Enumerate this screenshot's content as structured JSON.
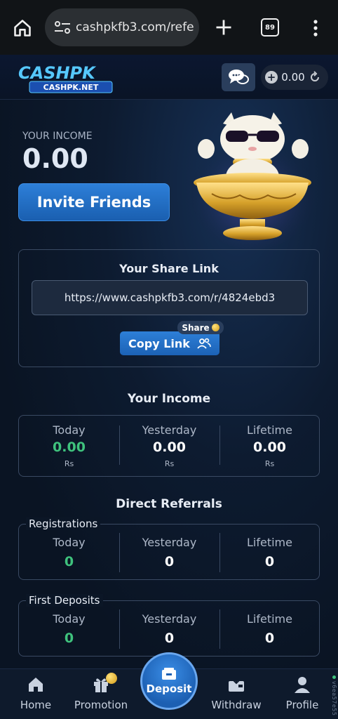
{
  "browser": {
    "url": "cashpkfb3.com/refe",
    "tab_count": "89"
  },
  "header": {
    "logo_main": "CASHPK",
    "logo_sub": "CASHPK.NET",
    "balance": "0.00"
  },
  "hero": {
    "income_label": "YOUR INCOME",
    "income_value": "0.00",
    "invite_label": "Invite Friends"
  },
  "share": {
    "title": "Your Share Link",
    "link": "https://www.cashpkfb3.com/r/4824ebd3",
    "copy_label": "Copy Link",
    "badge": "Share"
  },
  "income": {
    "title": "Your Income",
    "cols": [
      {
        "label": "Today",
        "value": "0.00",
        "unit": "Rs"
      },
      {
        "label": "Yesterday",
        "value": "0.00",
        "unit": "Rs"
      },
      {
        "label": "Lifetime",
        "value": "0.00",
        "unit": "Rs"
      }
    ]
  },
  "referrals": {
    "title": "Direct Referrals",
    "registrations": {
      "caption": "Registrations",
      "cols": [
        {
          "label": "Today",
          "value": "0"
        },
        {
          "label": "Yesterday",
          "value": "0"
        },
        {
          "label": "Lifetime",
          "value": "0"
        }
      ]
    },
    "first_deposits": {
      "caption": "First Deposits",
      "cols": [
        {
          "label": "Today",
          "value": "0"
        },
        {
          "label": "Yesterday",
          "value": "0"
        },
        {
          "label": "Lifetime",
          "value": "0"
        }
      ]
    }
  },
  "nav": {
    "home": "Home",
    "promotion": "Promotion",
    "deposit": "Deposit",
    "withdraw": "Withdraw",
    "profile": "Profile"
  },
  "side_tag": "v6ea57e55",
  "colors": {
    "accent_blue": "#2d7fd8",
    "positive_green": "#3fc27d",
    "background": "#0b1422"
  }
}
